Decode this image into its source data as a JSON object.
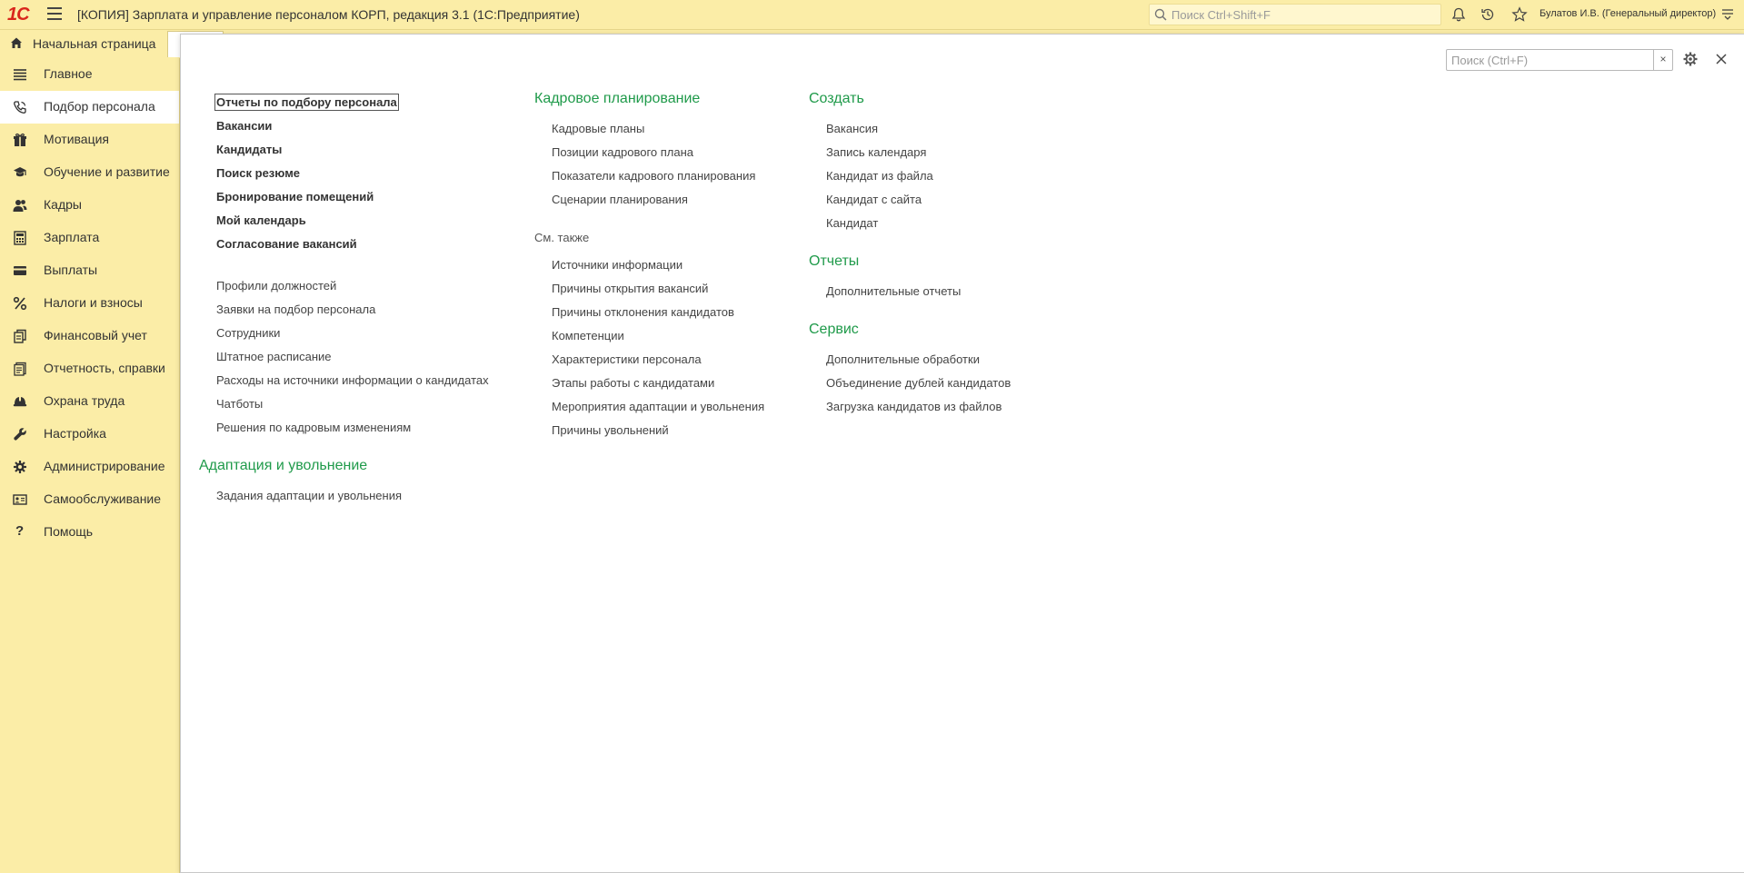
{
  "app": {
    "title": "[КОПИЯ] Зарплата и управление персоналом КОРП, редакция 3.1  (1С:Предприятие)",
    "search_placeholder": "Поиск Ctrl+Shift+F",
    "user": "Булатов И.В. (Генеральный директор)",
    "logo_icon": "1c-logo-icon"
  },
  "home_tab": {
    "label": "Начальная страница"
  },
  "sidebar": {
    "items": [
      {
        "label": "Главное",
        "icon": "menu-lines-icon"
      },
      {
        "label": "Подбор персонала",
        "icon": "phone-icon",
        "active": true
      },
      {
        "label": "Мотивация",
        "icon": "gift-icon"
      },
      {
        "label": "Обучение и развитие",
        "icon": "graduation-cap-icon"
      },
      {
        "label": "Кадры",
        "icon": "people-icon"
      },
      {
        "label": "Зарплата",
        "icon": "calculator-icon"
      },
      {
        "label": "Выплаты",
        "icon": "card-icon"
      },
      {
        "label": "Налоги и взносы",
        "icon": "percent-icon"
      },
      {
        "label": "Финансовый учет",
        "icon": "ledger-icon"
      },
      {
        "label": "Отчетность, справки",
        "icon": "reports-icon"
      },
      {
        "label": "Охрана труда",
        "icon": "helmet-icon"
      },
      {
        "label": "Настройка",
        "icon": "wrench-icon"
      },
      {
        "label": "Администрирование",
        "icon": "gear-icon"
      },
      {
        "label": "Самообслуживание",
        "icon": "id-card-icon"
      },
      {
        "label": "Помощь",
        "icon": "question-icon"
      }
    ]
  },
  "panel": {
    "search_placeholder": "Поиск (Ctrl+F)",
    "clear_label": "×",
    "col1": {
      "bold_links": [
        "Отчеты по подбору персонала",
        "Вакансии",
        "Кандидаты",
        "Поиск резюме",
        "Бронирование помещений",
        "Мой календарь",
        "Согласование вакансий"
      ],
      "links": [
        "Профили должностей",
        "Заявки на подбор персонала",
        "Сотрудники",
        "Штатное расписание",
        "Расходы на источники информации о кандидатах",
        "Чатботы",
        "Решения по кадровым изменениям"
      ],
      "section2_title": "Адаптация и увольнение",
      "section2_links": [
        "Задания адаптации и увольнения"
      ]
    },
    "col2": {
      "title": "Кадровое планирование",
      "links": [
        "Кадровые планы",
        "Позиции кадрового плана",
        "Показатели кадрового планирования",
        "Сценарии планирования"
      ],
      "see_also": "См. также",
      "see_also_links": [
        "Источники информации",
        "Причины открытия вакансий",
        "Причины отклонения кандидатов",
        "Компетенции",
        "Характеристики персонала",
        "Этапы работы с кандидатами",
        "Мероприятия адаптации и увольнения",
        "Причины увольнений"
      ]
    },
    "col3": {
      "create_title": "Создать",
      "create_links": [
        "Вакансия",
        "Запись календаря",
        "Кандидат из файла",
        "Кандидат с сайта",
        "Кандидат"
      ],
      "reports_title": "Отчеты",
      "reports_links": [
        "Дополнительные отчеты"
      ],
      "service_title": "Сервис",
      "service_links": [
        "Дополнительные обработки",
        "Объединение дублей кандидатов",
        "Загрузка кандидатов из файлов"
      ]
    }
  }
}
